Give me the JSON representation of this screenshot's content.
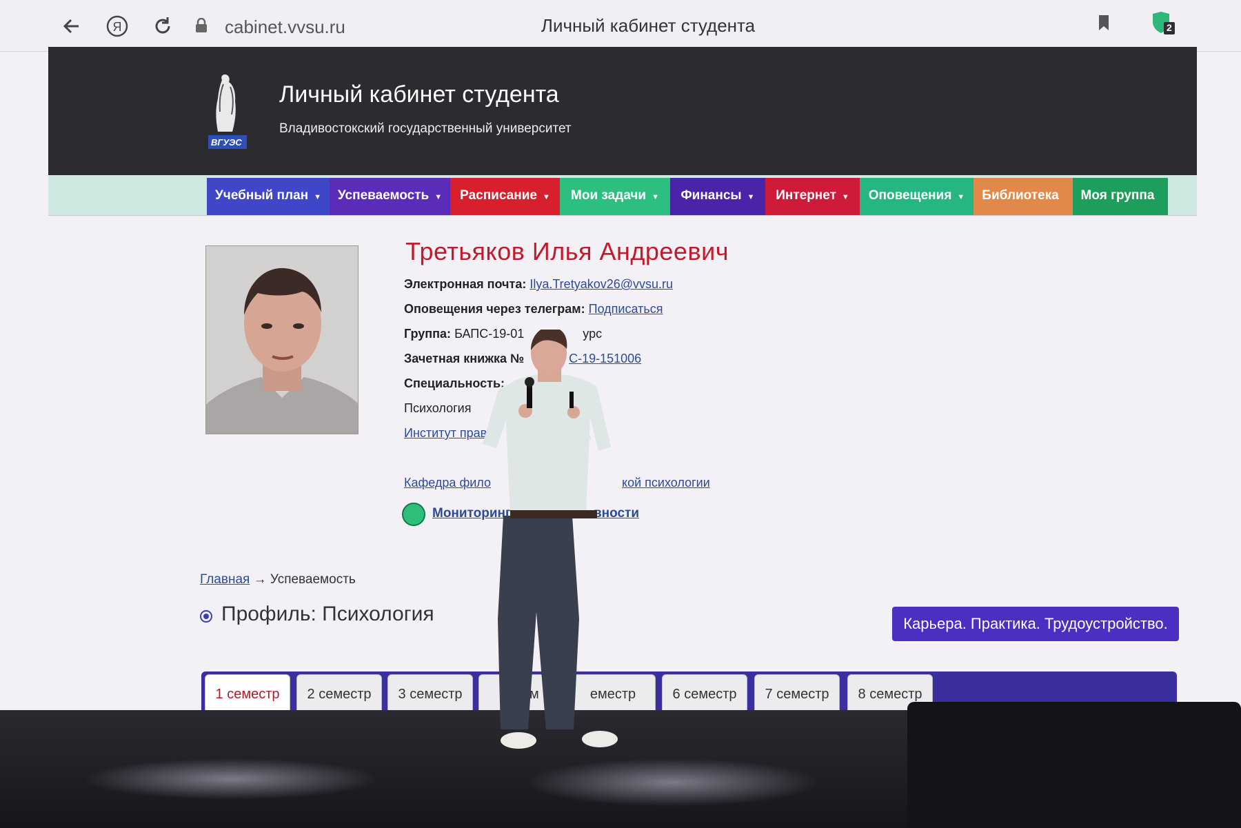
{
  "browser": {
    "url": "cabinet.vvsu.ru",
    "window_title": "Личный кабинет студента",
    "notifications_badge": "2"
  },
  "header": {
    "logo_text": "ВГУЭС",
    "title": "Личный кабинет студента",
    "subtitle": "Владивостокский государственный университет"
  },
  "nav": {
    "items": [
      {
        "label": "Учебный план",
        "caret": "▼",
        "color": "#3f46c8"
      },
      {
        "label": "Успеваемость",
        "caret": "▼",
        "color": "#5a2cb8"
      },
      {
        "label": "Расписание",
        "caret": "▼",
        "color": "#d81f2e"
      },
      {
        "label": "Мои задачи",
        "caret": "▼",
        "color": "#2cbf7f"
      },
      {
        "label": "Финансы",
        "caret": "▼",
        "color": "#4a24a8"
      },
      {
        "label": "Интернет",
        "caret": "▼",
        "color": "#d01a3a"
      },
      {
        "label": "Оповещения",
        "caret": "▼",
        "color": "#25b682"
      },
      {
        "label": "Библиотека",
        "caret": "",
        "color": "#e0894a"
      },
      {
        "label": "Моя группа",
        "caret": "",
        "color": "#1e9e5c"
      }
    ]
  },
  "student": {
    "name": "Третьяков Илья Андреевич",
    "email_label": "Электронная почта:",
    "email": "Ilya.Tretyakov26@vvsu.ru",
    "telegram_label": "Оповещения через телеграм:",
    "telegram_link": "Подписаться",
    "group_label": "Группа:",
    "group_value": "БАПС-19-01",
    "group_suffix": "урс",
    "record_label": "Зачетная книжка №",
    "record_value": "С-19-151006",
    "specialty_label": "Специальность:",
    "specialty_value": "Психология",
    "institute_link": "Институт права",
    "department_left": "Кафедра фило",
    "department_right": "кой психологии",
    "monitoring_left": "Мониторинг",
    "monitoring_right": "вности"
  },
  "breadcrumb": {
    "home": "Главная",
    "arrow": "→",
    "current": "Успеваемость"
  },
  "profile": {
    "title": "Профиль: Психология",
    "career_button": "Карьера. Практика. Трудоустройство."
  },
  "semesters": {
    "tabs": [
      "1 семестр",
      "2 семестр",
      "3 семестр",
      "4 сем",
      "еместр",
      "6 семестр",
      "7 семестр",
      "8 семестр"
    ],
    "tab_suffix_4": "р"
  },
  "colors": {
    "header_bg": "#2b2b30",
    "name_red": "#c21a2a",
    "link_blue": "#2d4a9a",
    "career_purple": "#4a2fc0"
  }
}
